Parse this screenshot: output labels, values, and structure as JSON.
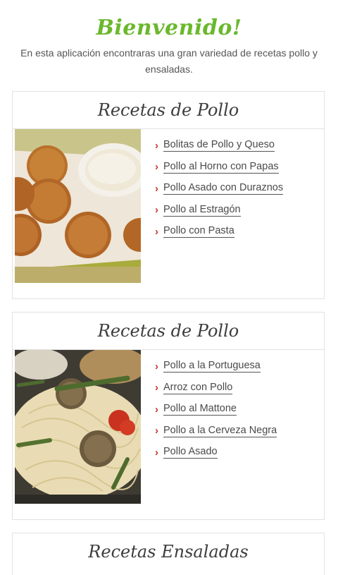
{
  "header": {
    "title": "Bienvenido!",
    "intro": "En esta aplicación encontraras una gran variedad de recetas pollo y ensaladas."
  },
  "sections": [
    {
      "title": "Recetas de Pollo",
      "image": "croquettes-photo",
      "links": [
        "Bolitas de Pollo y Queso",
        "Pollo al Horno con Papas",
        "Pollo Asado con Duraznos",
        "Pollo al Estragón",
        "Pollo con Pasta"
      ]
    },
    {
      "title": "Recetas de Pollo",
      "image": "pasta-meatballs-photo",
      "links": [
        "Pollo a la Portuguesa",
        "Arroz con Pollo",
        "Pollo al Mattone",
        "Pollo a la Cerveza Negra",
        "Pollo Asado"
      ]
    },
    {
      "title": "Recetas Ensaladas"
    }
  ],
  "colors": {
    "title_green": "#6ab82c",
    "arrow_red": "#c7352e",
    "border": "#e2e2e2"
  },
  "icons": {
    "link_bullet": "chevron-right-icon"
  }
}
